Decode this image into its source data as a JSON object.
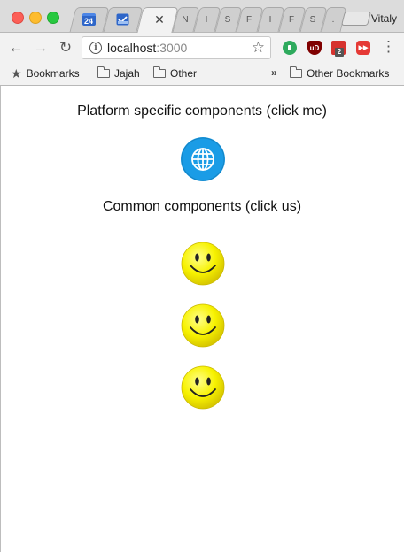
{
  "browser": {
    "tabs": [
      {
        "favicon": "calendar-icon",
        "label": "24"
      },
      {
        "favicon": "mail-tray-icon",
        "label": ""
      },
      {
        "favicon": "",
        "label": "",
        "active": true
      },
      {
        "label": "N"
      },
      {
        "label": "I"
      },
      {
        "label": "S"
      },
      {
        "label": "F"
      },
      {
        "label": "I"
      },
      {
        "label": "F"
      },
      {
        "label": "S"
      },
      {
        "label": "S"
      },
      {
        "label": "."
      }
    ],
    "profile_name": "Vitaly",
    "address": {
      "host": "localhost",
      "port": ":3000"
    },
    "extensions": [
      {
        "name": "green-circle-extension-icon",
        "text": ""
      },
      {
        "name": "ublock-extension-icon",
        "text": "uD"
      },
      {
        "name": "calendar-extension-icon",
        "text": "2"
      },
      {
        "name": "youtube-extension-icon",
        "text": "▶▶"
      }
    ],
    "bookmarks": {
      "items": [
        "Bookmarks",
        "Jajah",
        "Other"
      ],
      "overflow": "»",
      "other_label": "Other Bookmarks"
    }
  },
  "page": {
    "platform_heading": "Platform specific components (click me)",
    "common_heading": "Common components (click us)",
    "platform_component": {
      "icon": "globe-icon",
      "color": "#1a9ce6"
    },
    "common_components": [
      {
        "icon": "smiley-icon",
        "color": "#f7f200"
      },
      {
        "icon": "smiley-icon",
        "color": "#f7f200"
      },
      {
        "icon": "smiley-icon",
        "color": "#f7f200"
      }
    ]
  }
}
